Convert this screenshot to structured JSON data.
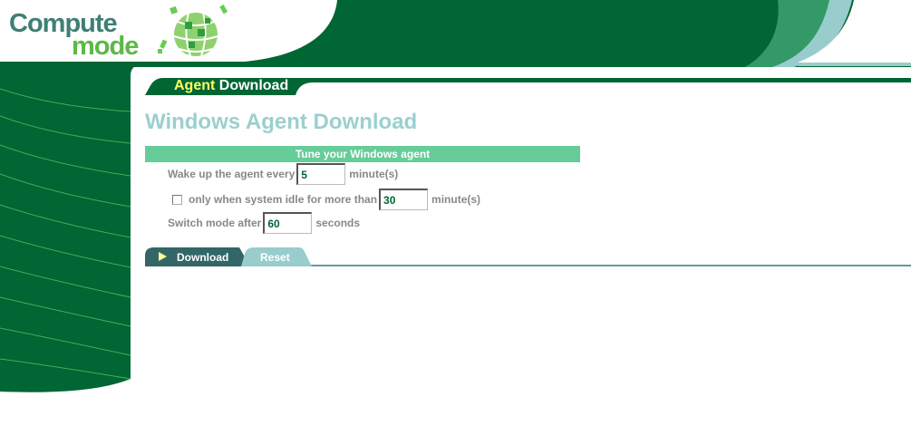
{
  "brand": {
    "line1": "Compute",
    "line2": "mode",
    "logo_icon": "globe-icon"
  },
  "tab": {
    "accent_word": "Agent",
    "rest_word": "Download"
  },
  "page": {
    "title": "Windows Agent Download"
  },
  "form": {
    "section_title": "Tune your Windows agent",
    "wake_label": "Wake up the agent every",
    "wake_value": "5",
    "wake_unit": "minute(s)",
    "idle_checked": false,
    "idle_label": "only when system idle for more than",
    "idle_value": "30",
    "idle_unit": "minute(s)",
    "switch_label": "Switch mode after",
    "switch_value": "60",
    "switch_unit": "seconds"
  },
  "actions": {
    "download_label": "Download",
    "download_icon": "play-triangle-icon",
    "reset_label": "Reset"
  },
  "colors": {
    "dark_green": "#006633",
    "mid_green": "#339966",
    "light_green": "#66cc99",
    "teal": "#99cccc",
    "title_teal": "#9ccfcf",
    "logo_teal": "#3f7f76",
    "logo_green": "#5cb848"
  }
}
